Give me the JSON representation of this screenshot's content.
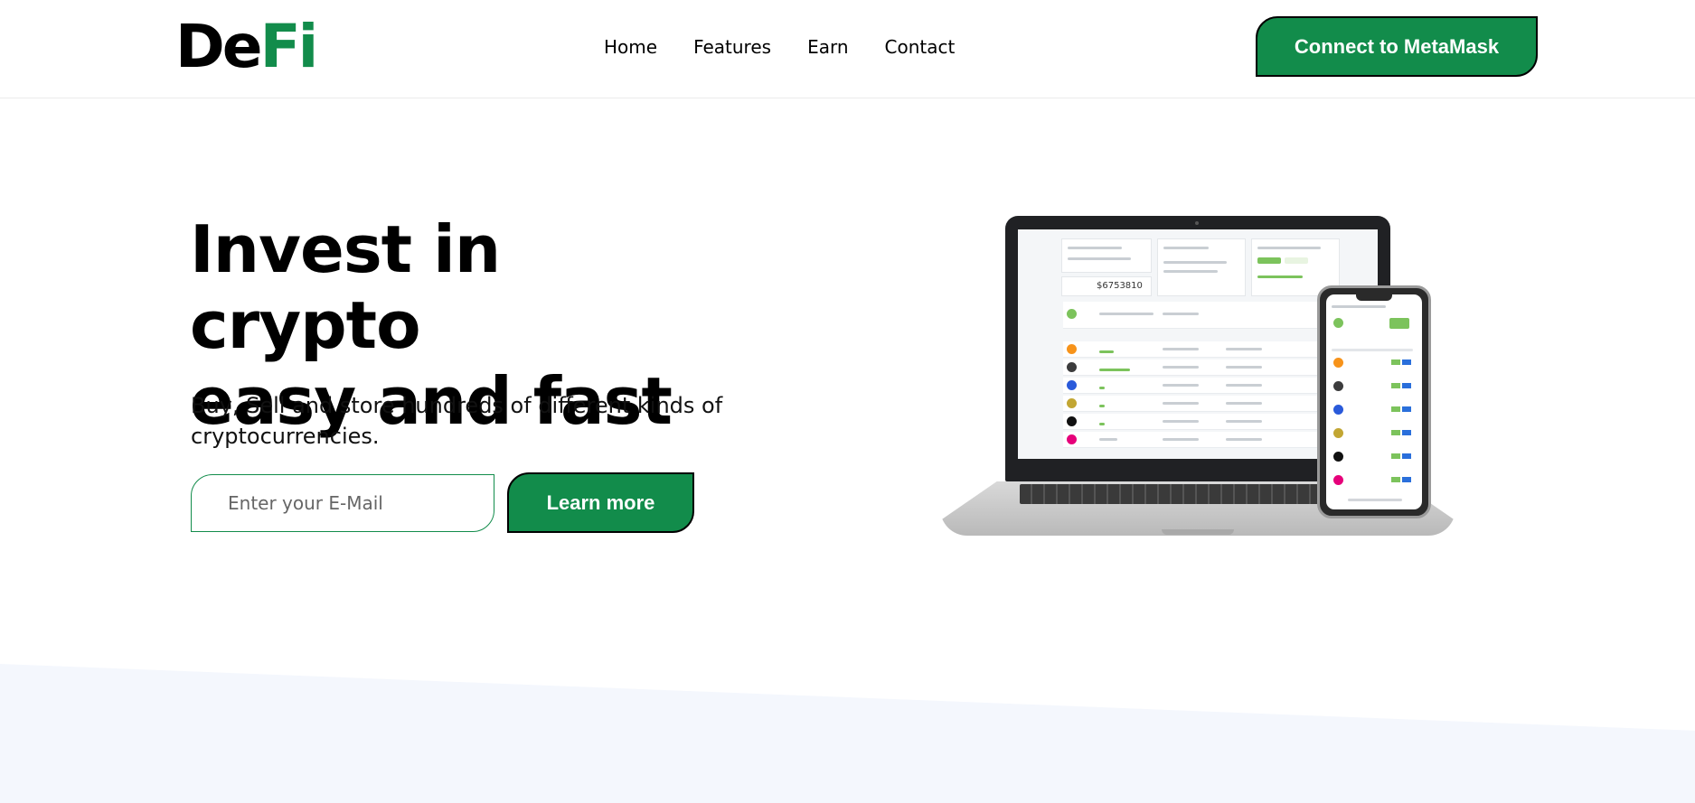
{
  "brand": {
    "part1": "De",
    "part2": "Fi"
  },
  "nav": {
    "items": [
      "Home",
      "Features",
      "Earn",
      "Contact"
    ]
  },
  "header": {
    "cta_label": "Connect to MetaMask"
  },
  "hero": {
    "title_line1": "Invest in crypto",
    "title_line2": "easy and fast",
    "subtitle": "Buy, Sell and store hundreds of different kinds of cryptocurrencies.",
    "email_placeholder": "Enter your E-Mail",
    "learn_more_label": "Learn more"
  },
  "mockup": {
    "portfolio_value": "$6753810",
    "coin_colors": [
      "#f7931a",
      "#3c3c3d",
      "#2a5ada",
      "#c2a633",
      "#111111",
      "#e6007a"
    ],
    "accent": "#7cc35c",
    "button_blue": "#2a6fdb"
  },
  "colors": {
    "brand_green": "#128c4b",
    "band": "#f4f7fd"
  }
}
